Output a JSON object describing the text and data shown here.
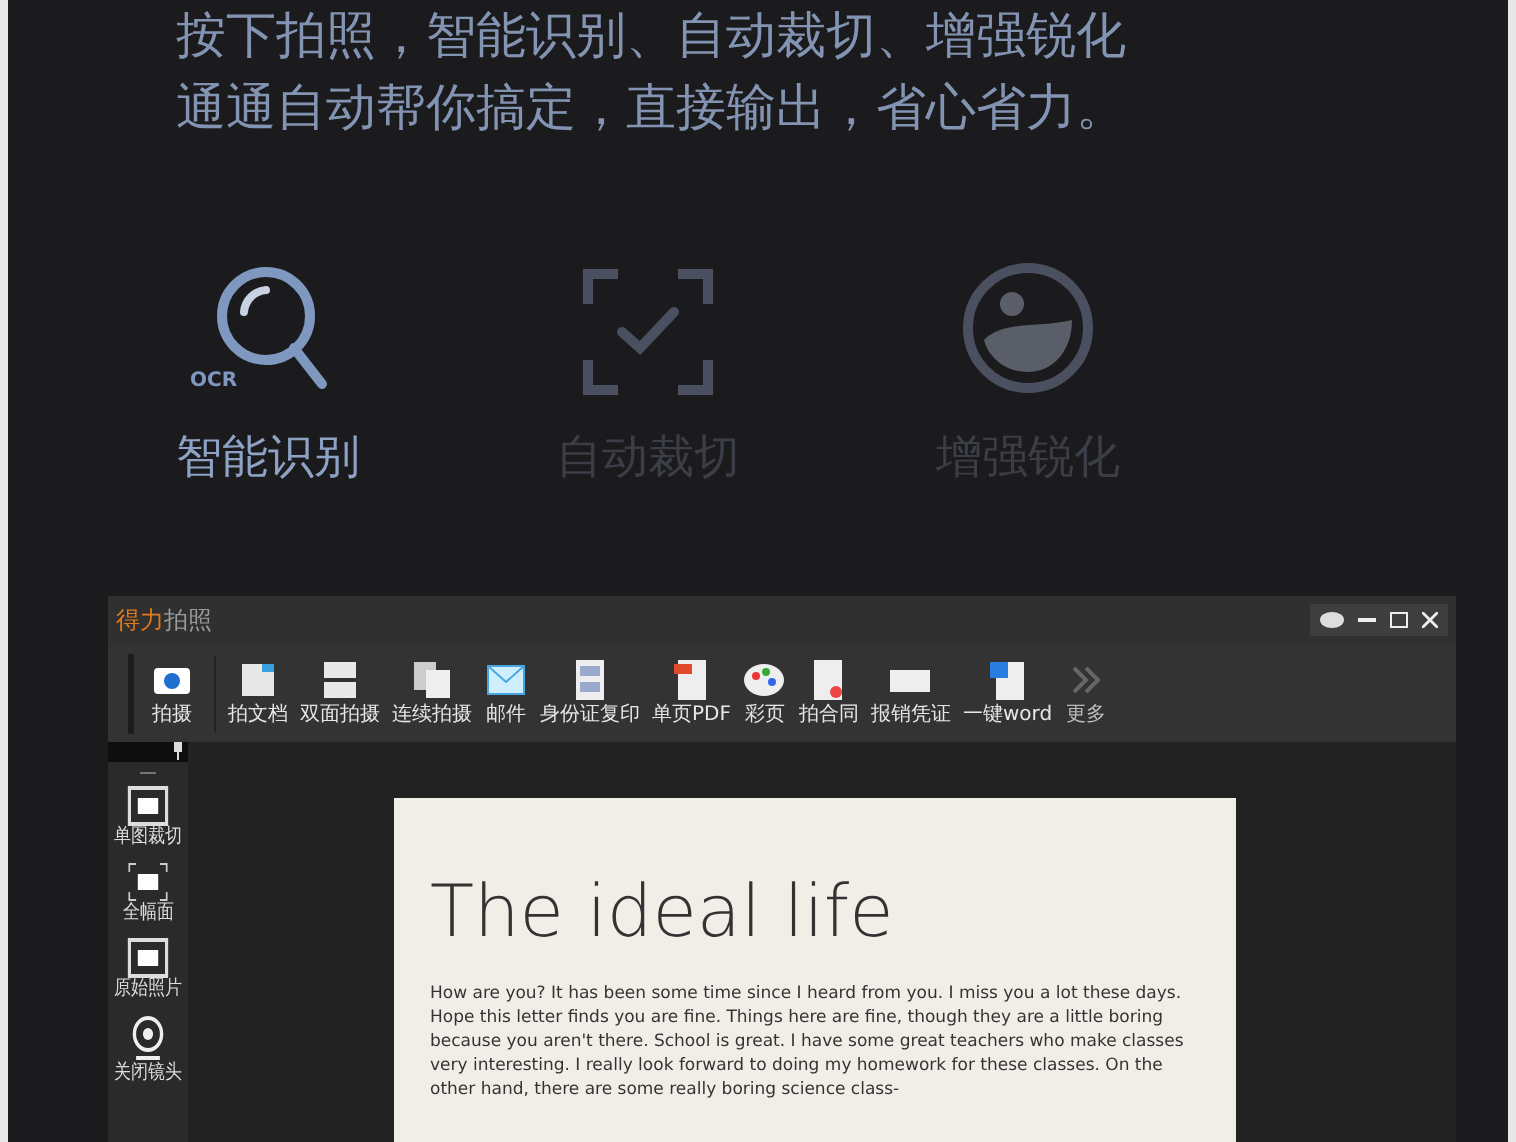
{
  "headline": [
    "按下拍照，智能识别、自动裁切、增强锐化",
    "通通自动帮你搞定，直接输出，省心省力。"
  ],
  "features": [
    {
      "label": "智能识别",
      "badge": "OCR",
      "selected": true
    },
    {
      "label": "自动裁切",
      "selected": false
    },
    {
      "label": "增强锐化",
      "selected": false
    }
  ],
  "app": {
    "title_brand": "得力",
    "title_rest": "拍照",
    "toolbar": [
      {
        "label": "拍摄"
      },
      {
        "label": "拍文档"
      },
      {
        "label": "双面拍摄"
      },
      {
        "label": "连续拍摄"
      },
      {
        "label": "邮件"
      },
      {
        "label": "身份证复印"
      },
      {
        "label": "单页PDF"
      },
      {
        "label": "彩页"
      },
      {
        "label": "拍合同"
      },
      {
        "label": "报销凭证"
      },
      {
        "label": "一键word"
      },
      {
        "label": "更多",
        "kind": "more"
      }
    ],
    "sidebar": [
      {
        "label": "单图裁切"
      },
      {
        "label": "全幅面"
      },
      {
        "label": "原始照片"
      },
      {
        "label": "关闭镜头"
      }
    ],
    "document": {
      "title": "The ideal life",
      "body": "How are you? It has been some time since I heard from you. I miss you a lot these days. Hope this letter finds you are fine. Things here are fine, though they are a little boring because you aren't there. School is great. I have some great teachers who make classes very interesting. I really look forward to doing my homework for these classes. On the other hand, there are some really boring science class-"
    }
  }
}
